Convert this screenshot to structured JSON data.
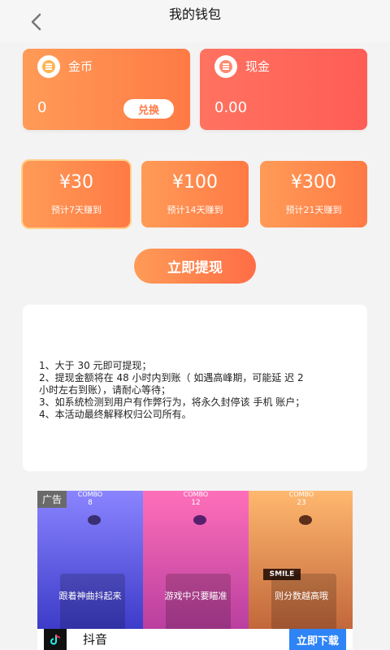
{
  "header": {
    "title": "我的钱包"
  },
  "cards": {
    "gold": {
      "label": "金币",
      "value": "0",
      "button": "兑换",
      "color": "#ff8a4c"
    },
    "cash": {
      "label": "现金",
      "value": "0.00",
      "color": "#ff5f57"
    }
  },
  "amounts": [
    {
      "value": "¥30",
      "subtitle": "预计7天赚到"
    },
    {
      "value": "¥100",
      "subtitle": "预计14天赚到"
    },
    {
      "value": "¥300",
      "subtitle": "预计21天赚到"
    }
  ],
  "withdraw_button": "立即提现",
  "rules": [
    "1、大于 30 元即可提现；",
    "2、提现金额将在 48 小时内到账（ 如遇高峰期，可能延 迟 2",
    "小时左右到账），请耐心等待；",
    "3、如系统检测到用户有作弊行为，将永久封停该 手机 账户；",
    "4、本活动最终解释权归公司所有。"
  ],
  "ad": {
    "badge": "广告",
    "panels": [
      {
        "top": "COMBO",
        "num": "8",
        "caption": "跟着神曲抖起来"
      },
      {
        "top": "COMBO",
        "num": "12",
        "caption": "游戏中只要瞄准"
      },
      {
        "top": "COMBO",
        "num": "23",
        "caption": "则分数越高哦"
      }
    ],
    "smile": "SMILE",
    "app_name": "抖音",
    "download": "立即下载"
  }
}
